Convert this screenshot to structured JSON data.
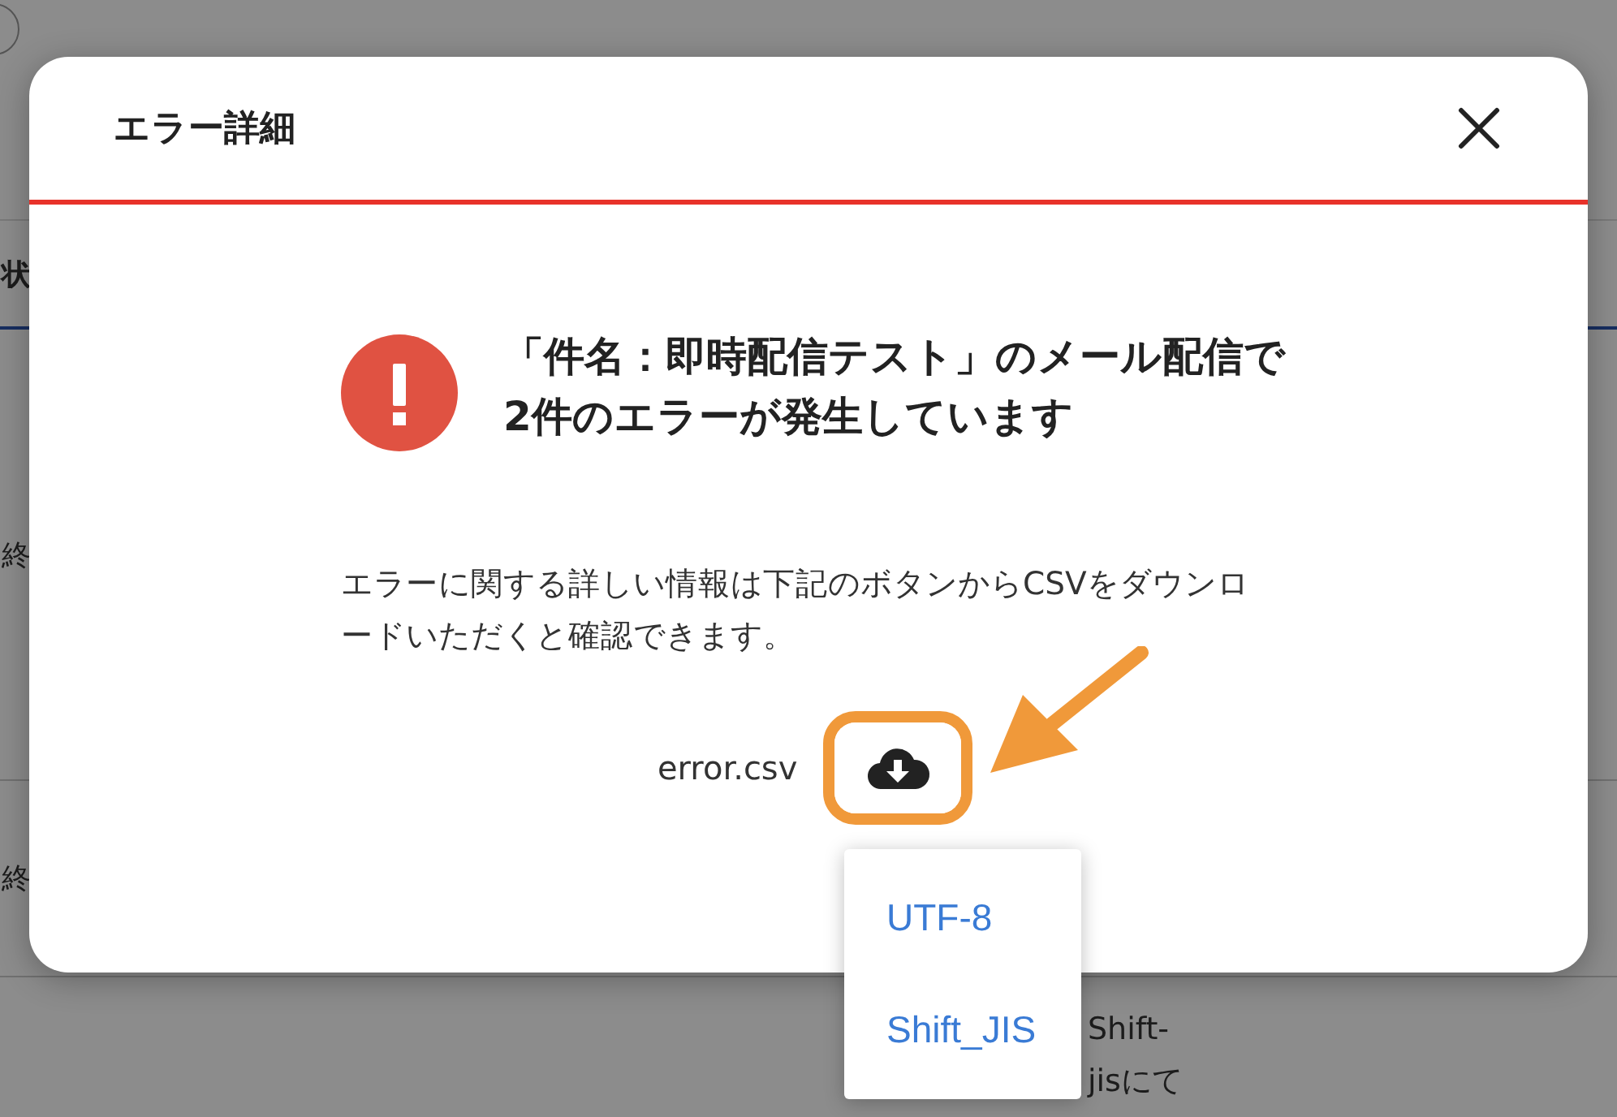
{
  "background": {
    "tab": "状",
    "rows": [
      "終",
      "終"
    ],
    "note_lines": [
      "Shift-",
      "jisにて"
    ]
  },
  "dialog": {
    "title": "エラー詳細",
    "message_lines": [
      "「件名：即時配信テスト」のメール配信で",
      "2件のエラーが発生しています"
    ],
    "description": "エラーに関する詳しい情報は下記のボタンからCSVをダウンロードいただくと確認できます。",
    "file_name": "error.csv"
  },
  "menu": {
    "items": [
      "UTF-8",
      "Shift_JIS"
    ]
  }
}
